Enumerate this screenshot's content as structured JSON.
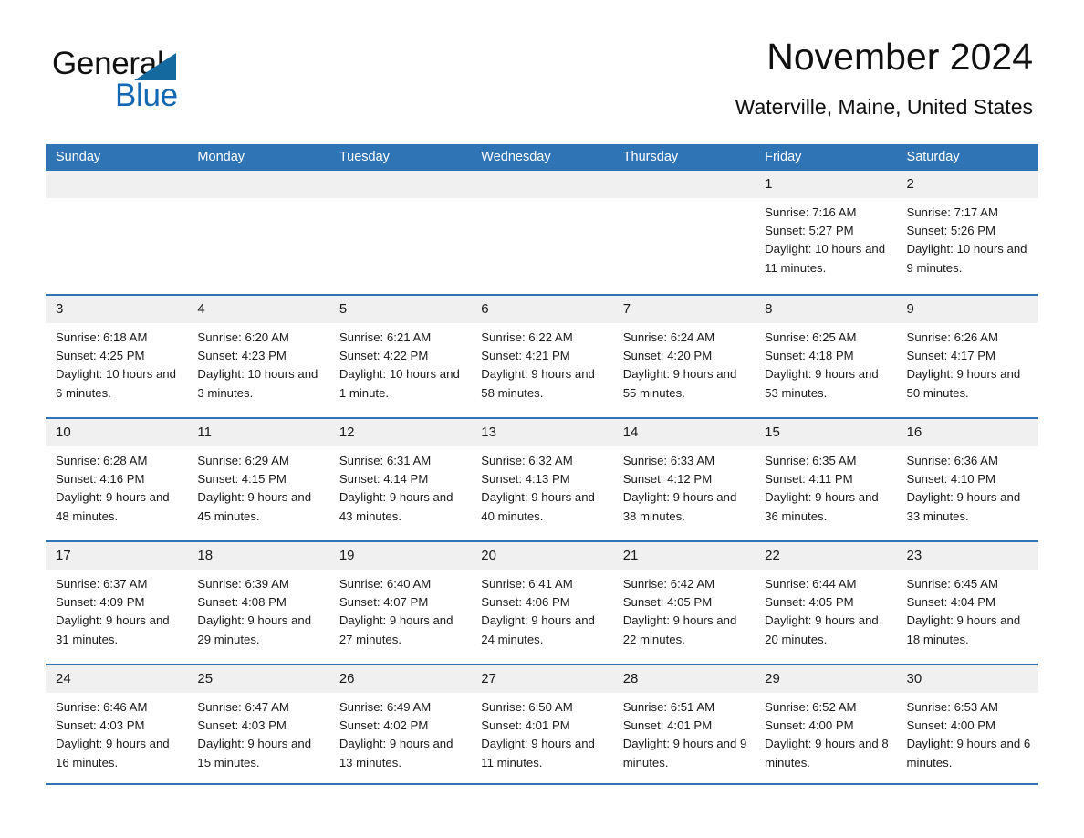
{
  "brand": {
    "word_one": "General",
    "word_two": "Blue",
    "triangle_color": "#14699e",
    "blue_color": "#1268b3"
  },
  "header": {
    "month_title": "November 2024",
    "location": "Waterville, Maine, United States"
  },
  "theme": {
    "header_blue": "#2f74b5",
    "day_band_gray": "#f0f0f0",
    "text_color": "#1a1a1a"
  },
  "weekdays": [
    "Sunday",
    "Monday",
    "Tuesday",
    "Wednesday",
    "Thursday",
    "Friday",
    "Saturday"
  ],
  "weeks": [
    [
      {
        "day": "",
        "sunrise": "",
        "sunset": "",
        "daylight": ""
      },
      {
        "day": "",
        "sunrise": "",
        "sunset": "",
        "daylight": ""
      },
      {
        "day": "",
        "sunrise": "",
        "sunset": "",
        "daylight": ""
      },
      {
        "day": "",
        "sunrise": "",
        "sunset": "",
        "daylight": ""
      },
      {
        "day": "",
        "sunrise": "",
        "sunset": "",
        "daylight": ""
      },
      {
        "day": "1",
        "sunrise": "Sunrise: 7:16 AM",
        "sunset": "Sunset: 5:27 PM",
        "daylight": "Daylight: 10 hours and 11 minutes."
      },
      {
        "day": "2",
        "sunrise": "Sunrise: 7:17 AM",
        "sunset": "Sunset: 5:26 PM",
        "daylight": "Daylight: 10 hours and 9 minutes."
      }
    ],
    [
      {
        "day": "3",
        "sunrise": "Sunrise: 6:18 AM",
        "sunset": "Sunset: 4:25 PM",
        "daylight": "Daylight: 10 hours and 6 minutes."
      },
      {
        "day": "4",
        "sunrise": "Sunrise: 6:20 AM",
        "sunset": "Sunset: 4:23 PM",
        "daylight": "Daylight: 10 hours and 3 minutes."
      },
      {
        "day": "5",
        "sunrise": "Sunrise: 6:21 AM",
        "sunset": "Sunset: 4:22 PM",
        "daylight": "Daylight: 10 hours and 1 minute."
      },
      {
        "day": "6",
        "sunrise": "Sunrise: 6:22 AM",
        "sunset": "Sunset: 4:21 PM",
        "daylight": "Daylight: 9 hours and 58 minutes."
      },
      {
        "day": "7",
        "sunrise": "Sunrise: 6:24 AM",
        "sunset": "Sunset: 4:20 PM",
        "daylight": "Daylight: 9 hours and 55 minutes."
      },
      {
        "day": "8",
        "sunrise": "Sunrise: 6:25 AM",
        "sunset": "Sunset: 4:18 PM",
        "daylight": "Daylight: 9 hours and 53 minutes."
      },
      {
        "day": "9",
        "sunrise": "Sunrise: 6:26 AM",
        "sunset": "Sunset: 4:17 PM",
        "daylight": "Daylight: 9 hours and 50 minutes."
      }
    ],
    [
      {
        "day": "10",
        "sunrise": "Sunrise: 6:28 AM",
        "sunset": "Sunset: 4:16 PM",
        "daylight": "Daylight: 9 hours and 48 minutes."
      },
      {
        "day": "11",
        "sunrise": "Sunrise: 6:29 AM",
        "sunset": "Sunset: 4:15 PM",
        "daylight": "Daylight: 9 hours and 45 minutes."
      },
      {
        "day": "12",
        "sunrise": "Sunrise: 6:31 AM",
        "sunset": "Sunset: 4:14 PM",
        "daylight": "Daylight: 9 hours and 43 minutes."
      },
      {
        "day": "13",
        "sunrise": "Sunrise: 6:32 AM",
        "sunset": "Sunset: 4:13 PM",
        "daylight": "Daylight: 9 hours and 40 minutes."
      },
      {
        "day": "14",
        "sunrise": "Sunrise: 6:33 AM",
        "sunset": "Sunset: 4:12 PM",
        "daylight": "Daylight: 9 hours and 38 minutes."
      },
      {
        "day": "15",
        "sunrise": "Sunrise: 6:35 AM",
        "sunset": "Sunset: 4:11 PM",
        "daylight": "Daylight: 9 hours and 36 minutes."
      },
      {
        "day": "16",
        "sunrise": "Sunrise: 6:36 AM",
        "sunset": "Sunset: 4:10 PM",
        "daylight": "Daylight: 9 hours and 33 minutes."
      }
    ],
    [
      {
        "day": "17",
        "sunrise": "Sunrise: 6:37 AM",
        "sunset": "Sunset: 4:09 PM",
        "daylight": "Daylight: 9 hours and 31 minutes."
      },
      {
        "day": "18",
        "sunrise": "Sunrise: 6:39 AM",
        "sunset": "Sunset: 4:08 PM",
        "daylight": "Daylight: 9 hours and 29 minutes."
      },
      {
        "day": "19",
        "sunrise": "Sunrise: 6:40 AM",
        "sunset": "Sunset: 4:07 PM",
        "daylight": "Daylight: 9 hours and 27 minutes."
      },
      {
        "day": "20",
        "sunrise": "Sunrise: 6:41 AM",
        "sunset": "Sunset: 4:06 PM",
        "daylight": "Daylight: 9 hours and 24 minutes."
      },
      {
        "day": "21",
        "sunrise": "Sunrise: 6:42 AM",
        "sunset": "Sunset: 4:05 PM",
        "daylight": "Daylight: 9 hours and 22 minutes."
      },
      {
        "day": "22",
        "sunrise": "Sunrise: 6:44 AM",
        "sunset": "Sunset: 4:05 PM",
        "daylight": "Daylight: 9 hours and 20 minutes."
      },
      {
        "day": "23",
        "sunrise": "Sunrise: 6:45 AM",
        "sunset": "Sunset: 4:04 PM",
        "daylight": "Daylight: 9 hours and 18 minutes."
      }
    ],
    [
      {
        "day": "24",
        "sunrise": "Sunrise: 6:46 AM",
        "sunset": "Sunset: 4:03 PM",
        "daylight": "Daylight: 9 hours and 16 minutes."
      },
      {
        "day": "25",
        "sunrise": "Sunrise: 6:47 AM",
        "sunset": "Sunset: 4:03 PM",
        "daylight": "Daylight: 9 hours and 15 minutes."
      },
      {
        "day": "26",
        "sunrise": "Sunrise: 6:49 AM",
        "sunset": "Sunset: 4:02 PM",
        "daylight": "Daylight: 9 hours and 13 minutes."
      },
      {
        "day": "27",
        "sunrise": "Sunrise: 6:50 AM",
        "sunset": "Sunset: 4:01 PM",
        "daylight": "Daylight: 9 hours and 11 minutes."
      },
      {
        "day": "28",
        "sunrise": "Sunrise: 6:51 AM",
        "sunset": "Sunset: 4:01 PM",
        "daylight": "Daylight: 9 hours and 9 minutes."
      },
      {
        "day": "29",
        "sunrise": "Sunrise: 6:52 AM",
        "sunset": "Sunset: 4:00 PM",
        "daylight": "Daylight: 9 hours and 8 minutes."
      },
      {
        "day": "30",
        "sunrise": "Sunrise: 6:53 AM",
        "sunset": "Sunset: 4:00 PM",
        "daylight": "Daylight: 9 hours and 6 minutes."
      }
    ]
  ]
}
